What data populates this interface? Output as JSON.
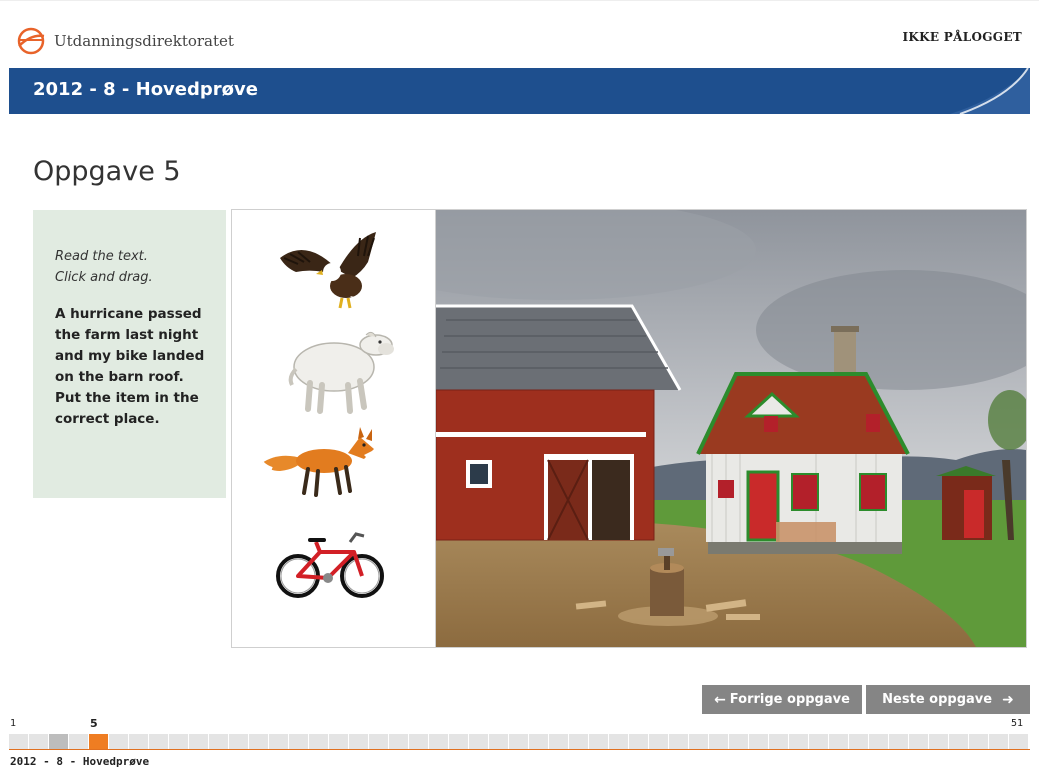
{
  "header": {
    "logo_text": "Utdanningsdirektoratet",
    "login_status": "IKKE PÅLOGGET",
    "test_title": "2012 - 8 - Hovedprøve",
    "brand_color": "#1e4f8e",
    "accent_color": "#ef7d22"
  },
  "task": {
    "heading": "Oppgave 5",
    "instruction_line1": "Read the text.",
    "instruction_line2": "Click and drag.",
    "body_text": "A hurricane passed the farm last night and my bike landed on the barn roof. Put the item in the correct place.",
    "drag_items": [
      {
        "name": "eagle",
        "icon": "eagle-icon"
      },
      {
        "name": "sheep",
        "icon": "sheep-icon"
      },
      {
        "name": "fox",
        "icon": "fox-icon"
      },
      {
        "name": "bicycle",
        "icon": "bicycle-icon"
      }
    ],
    "scene": "farm-scene"
  },
  "navigation": {
    "prev_label": "Forrige oppgave",
    "next_label": "Neste oppgave",
    "prev_icon": "arrow-left-icon",
    "next_icon": "arrow-right-icon"
  },
  "progress": {
    "first_label": "1",
    "current_label": "5",
    "last_label": "51",
    "total": 51,
    "current": 5,
    "visited": [
      3
    ]
  },
  "footer": {
    "test_title": "2012 - 8 - Hovedprøve"
  }
}
